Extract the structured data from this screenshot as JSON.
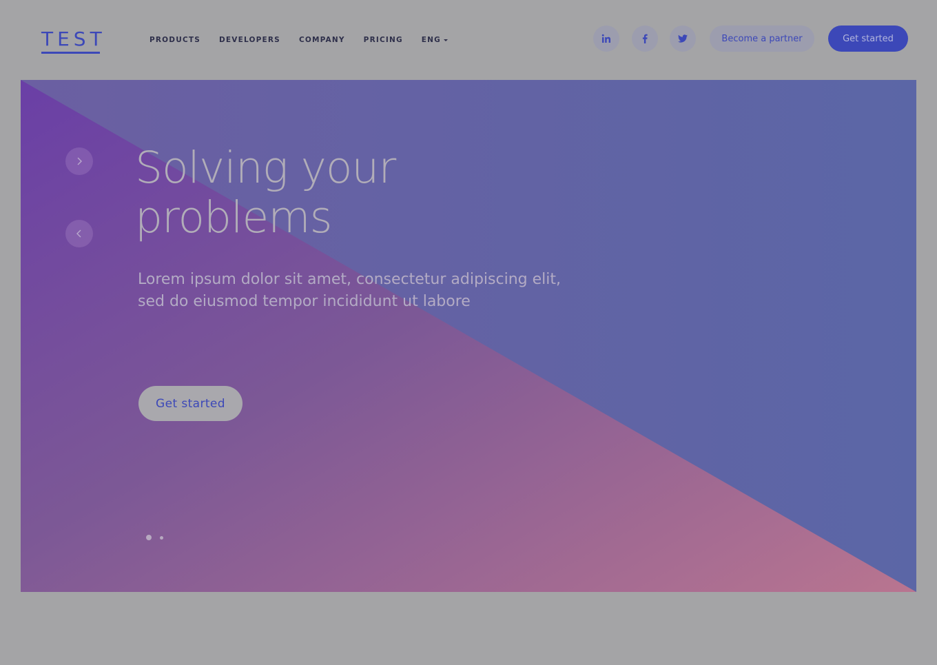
{
  "brand": {
    "logo_text": "TEST",
    "color": "#3c48b8"
  },
  "nav": {
    "items": [
      "PRODUCTS",
      "DEVELOPERS",
      "COMPANY",
      "PRICING"
    ],
    "language": "ENG"
  },
  "social": [
    {
      "name": "linkedin",
      "glyph": "in"
    },
    {
      "name": "facebook",
      "glyph": "f"
    },
    {
      "name": "twitter",
      "glyph": "twitter-bird"
    }
  ],
  "header": {
    "partner_label": "Become a partner",
    "start_label": "Get started"
  },
  "hero": {
    "title_line1": "Solving your",
    "title_line2": "problems",
    "subtitle": "Lorem ipsum dolor sit amet, consectetur adipiscing elit, sed do eiusmod tempor incididunt ut labore",
    "cta_label": "Get started",
    "slides_total": 2,
    "active_slide": 1
  },
  "colors": {
    "page_bg": "#a4a4a6",
    "accent": "#3c48b8",
    "gradient_purple": "#6a3fa6",
    "gradient_pink": "#b97590",
    "gradient_blue": "#5b66a5"
  }
}
